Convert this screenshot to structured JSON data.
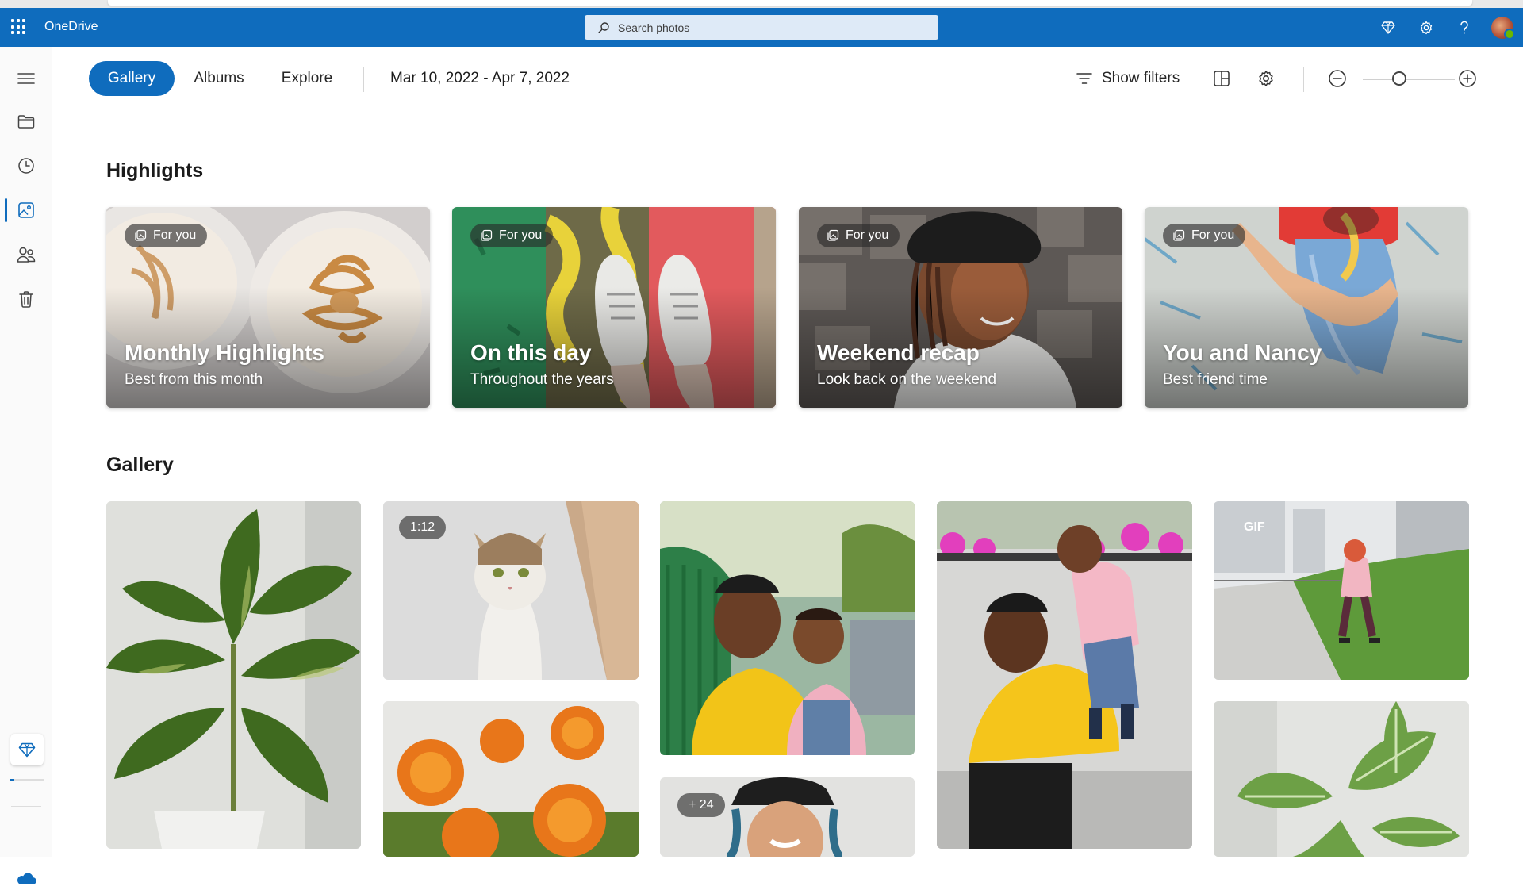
{
  "app": {
    "brand": "OneDrive",
    "search_placeholder": "Search photos"
  },
  "colors": {
    "accent": "#0f6cbd",
    "header_bg": "#0f6cbd"
  },
  "rail": {
    "items": [
      {
        "name": "menu",
        "icon": "hamburger-icon"
      },
      {
        "name": "my-files",
        "icon": "folder-icon"
      },
      {
        "name": "recent",
        "icon": "clock-icon"
      },
      {
        "name": "photos",
        "icon": "photo-icon",
        "active": true
      },
      {
        "name": "shared",
        "icon": "people-icon"
      },
      {
        "name": "recycle-bin",
        "icon": "trash-icon"
      }
    ],
    "storage_fraction": 0.15
  },
  "toolbar": {
    "tabs": [
      {
        "label": "Gallery",
        "active": true
      },
      {
        "label": "Albums",
        "active": false
      },
      {
        "label": "Explore",
        "active": false
      }
    ],
    "date_range": "Mar 10, 2022 - Apr 7, 2022",
    "show_filters": "Show filters",
    "zoom_level": 0.4
  },
  "highlights": {
    "title": "Highlights",
    "cards": [
      {
        "chip": "For you",
        "title": "Monthly Highlights",
        "subtitle": "Best from this month"
      },
      {
        "chip": "For you",
        "title": "On this day",
        "subtitle": "Throughout the years"
      },
      {
        "chip": "For you",
        "title": "Weekend recap",
        "subtitle": "Look back on the weekend"
      },
      {
        "chip": "For you",
        "title": "You and Nancy",
        "subtitle": "Best friend time"
      }
    ]
  },
  "gallery": {
    "title": "Gallery",
    "badges": {
      "video_duration": "1:12",
      "gif": "GIF",
      "more_count": "+ 24"
    }
  }
}
